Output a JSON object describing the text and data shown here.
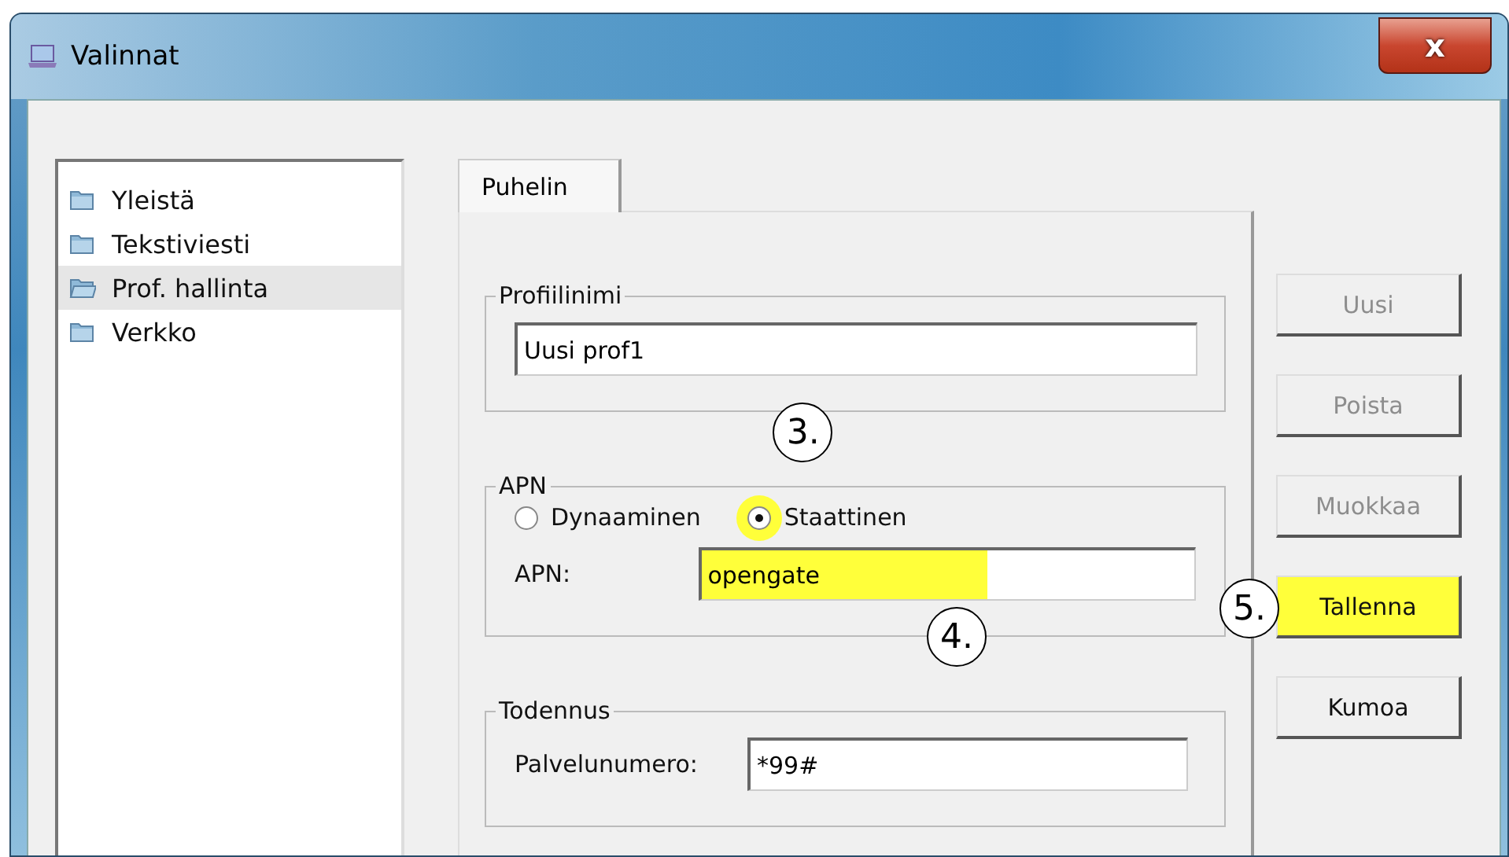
{
  "window": {
    "title": "Valinnat",
    "close_label": "x"
  },
  "sidebar": {
    "items": [
      {
        "label": "Yleistä",
        "selected": false
      },
      {
        "label": "Tekstiviesti",
        "selected": false
      },
      {
        "label": "Prof. hallinta",
        "selected": true
      },
      {
        "label": "Verkko",
        "selected": false
      }
    ]
  },
  "tabs": [
    {
      "label": "Puhelin",
      "selected": true
    }
  ],
  "profile_group": {
    "title": "Profiilinimi",
    "value": "Uusi prof1"
  },
  "apn_group": {
    "title": "APN",
    "options": [
      {
        "label": "Dynaaminen",
        "selected": false,
        "highlighted": false
      },
      {
        "label": "Staattinen",
        "selected": true,
        "highlighted": true,
        "marker": "3."
      }
    ],
    "field_label": "APN:",
    "value": "opengate",
    "highlighted": true,
    "marker": "4."
  },
  "auth_group": {
    "title": "Todennus",
    "field_label": "Palvelunumero:",
    "value": "*99#"
  },
  "buttons": [
    {
      "label": "Uusi",
      "disabled": true,
      "highlighted": false
    },
    {
      "label": "Poista",
      "disabled": true,
      "highlighted": false
    },
    {
      "label": "Muokkaa",
      "disabled": true,
      "highlighted": false
    },
    {
      "label": "Tallenna",
      "disabled": false,
      "highlighted": true,
      "marker": "5."
    },
    {
      "label": "Kumoa",
      "disabled": false,
      "highlighted": false
    }
  ]
}
